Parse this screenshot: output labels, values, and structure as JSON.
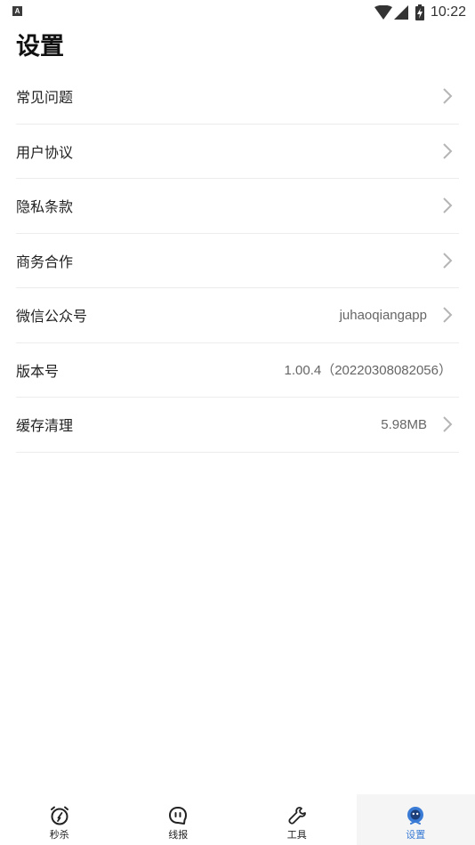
{
  "status_bar": {
    "notification_badge": "A",
    "time": "10:22",
    "icons": [
      "wifi-icon",
      "signal-icon",
      "battery-charging-icon"
    ]
  },
  "page": {
    "title": "设置"
  },
  "settings": {
    "items": [
      {
        "label": "常见问题",
        "value": ""
      },
      {
        "label": "用户协议",
        "value": ""
      },
      {
        "label": "隐私条款",
        "value": ""
      },
      {
        "label": "商务合作",
        "value": ""
      },
      {
        "label": "微信公众号",
        "value": "juhaoqiangapp"
      },
      {
        "label": "版本号",
        "value": "1.00.4（20220308082056）"
      },
      {
        "label": "缓存清理",
        "value": "5.98MB"
      }
    ]
  },
  "bottom_nav": {
    "items": [
      {
        "label": "秒杀",
        "icon": "alarm-clock-icon"
      },
      {
        "label": "线报",
        "icon": "chat-bubble-icon"
      },
      {
        "label": "工具",
        "icon": "wrench-icon"
      },
      {
        "label": "设置",
        "icon": "settings-avatar-icon"
      }
    ],
    "active_index": 3,
    "active_color": "#3a7bd5"
  }
}
